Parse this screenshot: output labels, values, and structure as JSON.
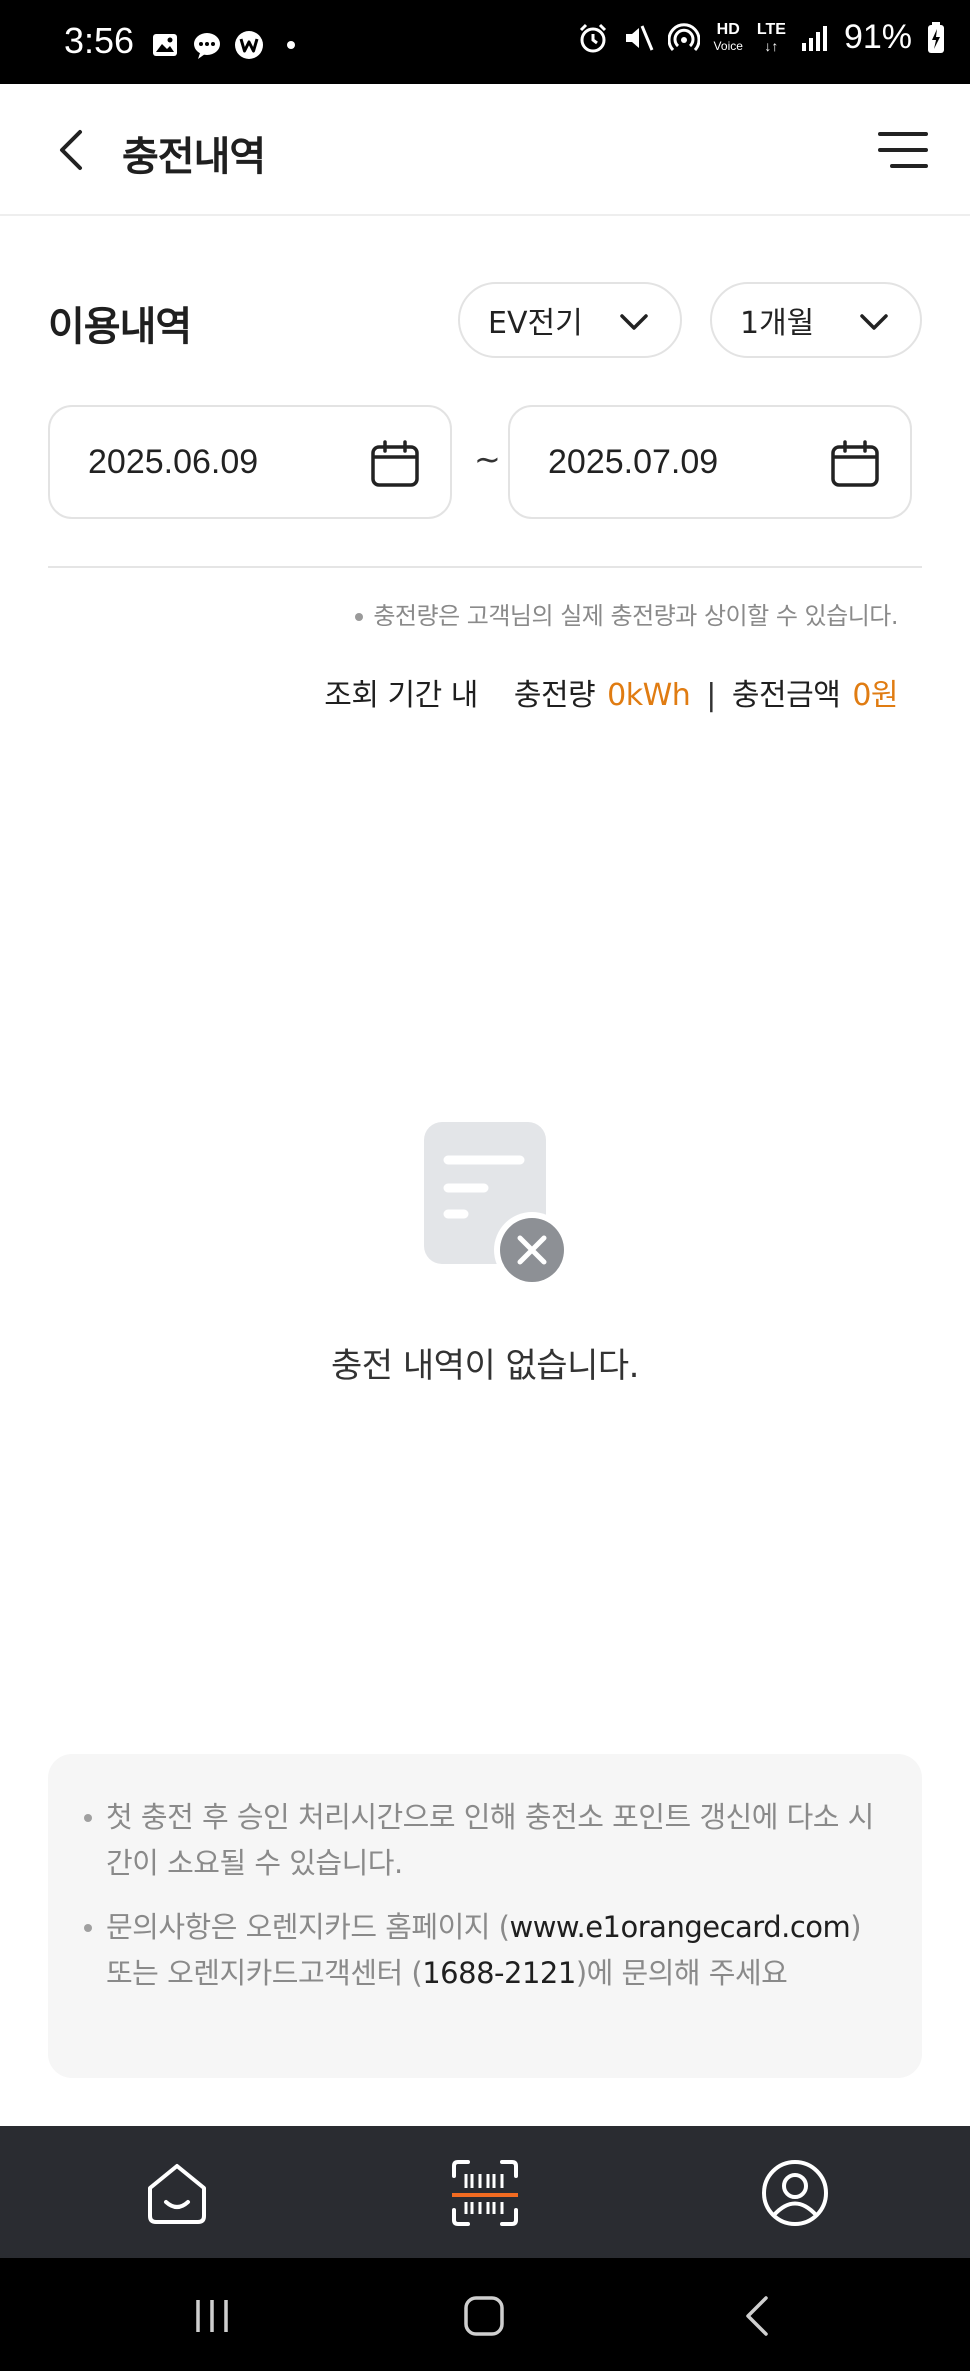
{
  "status_bar": {
    "time": "3:56",
    "network": "LTE",
    "hd_voice_top": "HD",
    "hd_voice_bottom": "Voice",
    "battery": "91%"
  },
  "header": {
    "title": "충전내역"
  },
  "usage": {
    "section_title": "이용내역",
    "type_select": "EV전기",
    "period_select": "1개월",
    "start_date": "2025.06.09",
    "end_date": "2025.07.09",
    "range_separator": "~",
    "note": "충전량은 고객님의 실제 충전량과 상이할 수 있습니다.",
    "summary": {
      "label_period": "조회 기간 내",
      "label_amount": "충전량",
      "amount_value": "0kWh",
      "separator": "|",
      "label_price": "충전금액",
      "price_value": "0원"
    }
  },
  "empty_state": {
    "message": "충전 내역이 없습니다."
  },
  "info": {
    "item1": "첫 충전 후 승인 처리시간으로 인해 충전소 포인트 갱신에 다소 시간이 소요될 수 있습니다.",
    "item2_prefix": "문의사항은 오렌지카드 홈페이지 (",
    "item2_url": "www.e1orangecard.com",
    "item2_middle": ") 또는 오렌지카드고객센터 (",
    "item2_phone": "1688-2121",
    "item2_suffix": ")에 문의해 주세요"
  },
  "colors": {
    "accent": "#e07c12",
    "nav_bg": "#2a2c31",
    "scan_accent": "#f26b21"
  },
  "icons": {
    "back": "chevron-left-icon",
    "menu": "hamburger-menu-icon",
    "calendar": "calendar-icon",
    "empty": "document-x-icon",
    "nav_home": "home-icon",
    "nav_scan": "barcode-scan-icon",
    "nav_my": "user-profile-icon"
  }
}
